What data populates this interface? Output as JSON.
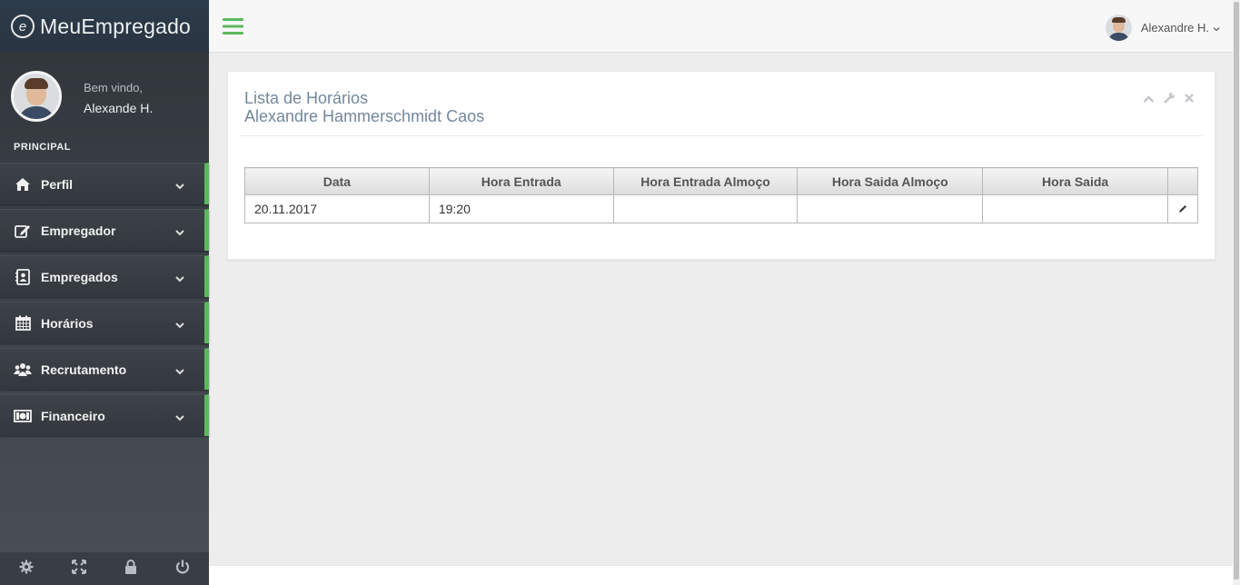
{
  "app": {
    "brand": "MeuEmpregado",
    "brand_logo": "e"
  },
  "profile": {
    "welcome": "Bem vindo,",
    "name": "Alexande H."
  },
  "sidebar": {
    "section_title": "PRINCIPAL",
    "items": [
      {
        "label": "Perfil",
        "icon": "home-icon"
      },
      {
        "label": "Empregador",
        "icon": "edit-icon"
      },
      {
        "label": "Empregados",
        "icon": "contact-book-icon"
      },
      {
        "label": "Horários",
        "icon": "calendar-icon"
      },
      {
        "label": "Recrutamento",
        "icon": "users-icon"
      },
      {
        "label": "Financeiro",
        "icon": "money-icon"
      }
    ],
    "accent_color": "#5cb85c"
  },
  "topnav": {
    "user_name": "Alexandre H."
  },
  "panel": {
    "title_line1": "Lista de Horários",
    "title_line2": "Alexandre Hammerschmidt Caos"
  },
  "table": {
    "headers": [
      "Data",
      "Hora Entrada",
      "Hora Entrada Almoço",
      "Hora Saida Almoço",
      "Hora Saida"
    ],
    "rows": [
      [
        "20.11.2017",
        "19:20",
        "",
        "",
        ""
      ]
    ]
  }
}
